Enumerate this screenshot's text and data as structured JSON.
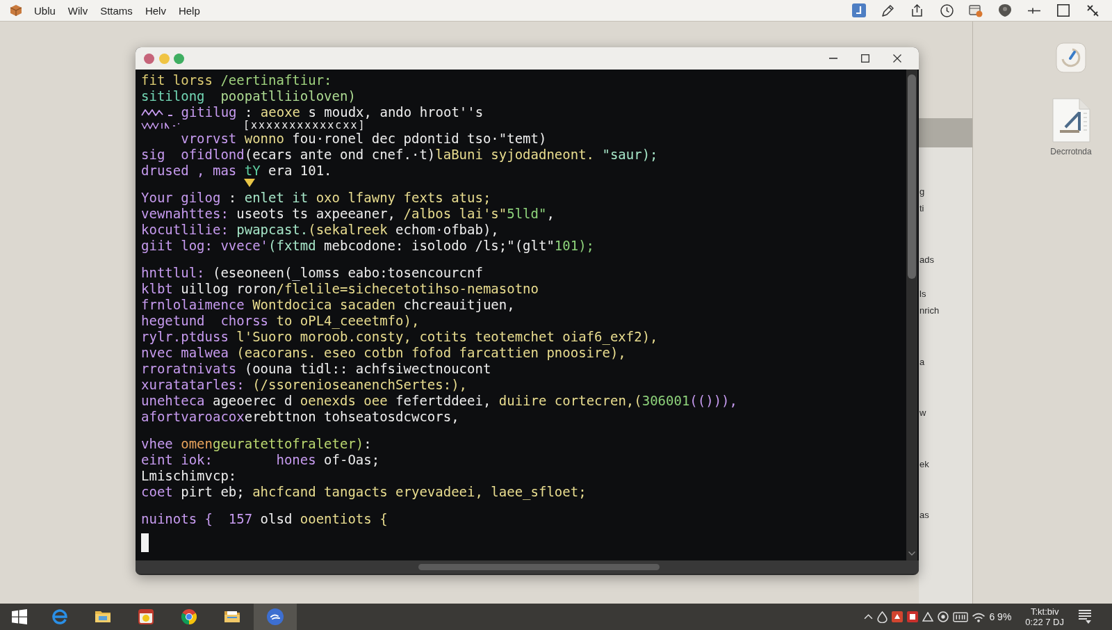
{
  "menu_bar": {
    "items": [
      "Ublu",
      "Wilv",
      "Sttams",
      "Helv",
      "Help"
    ]
  },
  "desktop": {
    "icons": [
      {
        "kind": "gauge"
      },
      {
        "kind": "document",
        "label": "Decrrotnda"
      }
    ]
  },
  "background_window": {
    "labels": [
      "g",
      "ti",
      "ads",
      "ls",
      "nrich",
      "a",
      "w",
      "ek",
      "as"
    ]
  },
  "terminal": {
    "blocks": [
      {
        "lines": [
          {
            "kind": "plain",
            "segments": [
              {
                "text": "fit lorss",
                "color": "#dccb72"
              },
              {
                "text": " /eertinaftiur:",
                "color": "#9fd27e"
              }
            ]
          },
          {
            "kind": "plain",
            "segments": [
              {
                "text": "sitilong",
                "color": "#72d6b4"
              },
              {
                "text": "  poopatlliioloven)",
                "color": "#addb92"
              }
            ]
          },
          {
            "kind": "wavy",
            "segments": [
              {
                "text": " gitilug",
                "color": "#c79bf0"
              },
              {
                "text": " :",
                "color": "#eeeeee"
              },
              {
                "text": " aeoxe",
                "color": "#e9dd8f"
              },
              {
                "text": " s moudx, ando hroot''s",
                "color": "#eeeeee"
              }
            ]
          },
          {
            "kind": "note",
            "segments": [
              {
                "text": "[xxxxxxxxxxxcxx]",
                "color": "#eeeeee"
              }
            ]
          },
          {
            "kind": "plain",
            "segments": [
              {
                "text": "     vrorvst",
                "color": "#c79bf0"
              },
              {
                "text": " wonno",
                "color": "#e9dd8f"
              },
              {
                "text": " fou·ronel dec pdontid tso·\"temt)",
                "color": "#eeeeee"
              }
            ]
          },
          {
            "kind": "plain",
            "segments": [
              {
                "text": "sig  ofidlond",
                "color": "#c79bf0"
              },
              {
                "text": "(ecars ante ond cnef.·t)",
                "color": "#eeeeee"
              },
              {
                "text": "laBuni syjodadneont.",
                "color": "#e9dd8f"
              },
              {
                "text": " \"saur);",
                "color": "#a6e6c8"
              }
            ]
          },
          {
            "kind": "marked",
            "segments": [
              {
                "text": "drused , mas",
                "color": "#c79bf0"
              },
              {
                "text": " tY",
                "color": "#5fd0a2"
              },
              {
                "text": " era 101.",
                "color": "#eeeeee"
              }
            ]
          }
        ]
      },
      {
        "lines": [
          {
            "kind": "plain",
            "segments": [
              {
                "text": "Your gilog",
                "color": "#c79bf0"
              },
              {
                "text": " :",
                "color": "#eeeeee"
              },
              {
                "text": " enlet it",
                "color": "#a6e6c8"
              },
              {
                "text": " oxo lfawny fexts atus;",
                "color": "#e9dd8f"
              }
            ]
          },
          {
            "kind": "plain",
            "segments": [
              {
                "text": "vewnahttes:",
                "color": "#c79bf0"
              },
              {
                "text": " useots ts axpeeaner,",
                "color": "#eeeeee"
              },
              {
                "text": " /albos lai's\"",
                "color": "#e9dd8f"
              },
              {
                "text": "5lld\"",
                "color": "#8ed37b"
              },
              {
                "text": ",",
                "color": "#eeeeee"
              }
            ]
          },
          {
            "kind": "plain",
            "segments": [
              {
                "text": "kocutlilie:",
                "color": "#c79bf0"
              },
              {
                "text": " pwapcast.",
                "color": "#a6e6c8"
              },
              {
                "text": "(sekalreek",
                "color": "#e9dd8f"
              },
              {
                "text": " echom·ofbab),",
                "color": "#eeeeee"
              }
            ]
          },
          {
            "kind": "plain",
            "segments": [
              {
                "text": "giit log: vvece'",
                "color": "#c79bf0"
              },
              {
                "text": "(fxtmd",
                "color": "#a6e6c8"
              },
              {
                "text": " mebcodone: isolodo /ls;\"(glt\"",
                "color": "#eeeeee"
              },
              {
                "text": "101);",
                "color": "#8ed37b"
              }
            ]
          }
        ]
      },
      {
        "lines": [
          {
            "kind": "plain",
            "segments": [
              {
                "text": "hnttlul:",
                "color": "#c79bf0"
              },
              {
                "text": " (eseoneen(_lomss eabo:tosencourcnf",
                "color": "#eeeeee"
              }
            ]
          },
          {
            "kind": "plain",
            "segments": [
              {
                "text": "klbt",
                "color": "#c79bf0"
              },
              {
                "text": " uillog roron",
                "color": "#eeeeee"
              },
              {
                "text": "/flelile=sichecetotihso-nemasotno",
                "color": "#e9dd8f"
              }
            ]
          },
          {
            "kind": "plain",
            "segments": [
              {
                "text": "frnlolaimence",
                "color": "#c79bf0"
              },
              {
                "text": " Wontdocica sacaden",
                "color": "#e9dd8f"
              },
              {
                "text": " chcreauitjuen,",
                "color": "#eeeeee"
              }
            ]
          },
          {
            "kind": "plain",
            "segments": [
              {
                "text": "hegetund  chorss",
                "color": "#c79bf0"
              },
              {
                "text": " to oPL4_ceeetmfo),",
                "color": "#e9dd8f"
              }
            ]
          },
          {
            "kind": "plain",
            "segments": [
              {
                "text": "rylr.ptduss",
                "color": "#c79bf0"
              },
              {
                "text": " l'Suoro moroob.consty, cotits teotemchet oiaf6_exf2),",
                "color": "#e9dd8f"
              }
            ]
          },
          {
            "kind": "plain",
            "segments": [
              {
                "text": "nvec malwea",
                "color": "#c79bf0"
              },
              {
                "text": " (eacorans. eseo cotbn fofod farcattien pnoosire),",
                "color": "#e9dd8f"
              }
            ]
          },
          {
            "kind": "plain",
            "segments": [
              {
                "text": "rroratnivats",
                "color": "#c79bf0"
              },
              {
                "text": " (oouna tidl:: achfsiwectnoucont",
                "color": "#eeeeee"
              }
            ]
          },
          {
            "kind": "plain",
            "segments": [
              {
                "text": "xuratatarles:",
                "color": "#c79bf0"
              },
              {
                "text": " (/ssorenioseanenchSertes:),",
                "color": "#e9dd8f"
              }
            ]
          },
          {
            "kind": "plain",
            "segments": [
              {
                "text": "unehteca",
                "color": "#c79bf0"
              },
              {
                "text": " ageoerec d",
                "color": "#eeeeee"
              },
              {
                "text": " oenexds oee",
                "color": "#e9dd8f"
              },
              {
                "text": " fefertddeei,",
                "color": "#eeeeee"
              },
              {
                "text": " duiire cortecren,(",
                "color": "#e9dd8f"
              },
              {
                "text": "306001",
                "color": "#8ed37b"
              },
              {
                "text": "(())),",
                "color": "#c79bf0"
              }
            ]
          },
          {
            "kind": "plain",
            "segments": [
              {
                "text": "afortvaroacox",
                "color": "#c79bf0"
              },
              {
                "text": "erebttnon tohseatosdcwcors,",
                "color": "#eeeeee"
              }
            ]
          }
        ]
      },
      {
        "lines": [
          {
            "kind": "plain",
            "segments": [
              {
                "text": "vhee",
                "color": "#c79bf0"
              },
              {
                "text": " omen",
                "color": "#e8a35c"
              },
              {
                "text": "geuratettofraleter)",
                "color": "#bcd970"
              },
              {
                "text": ":",
                "color": "#eeeeee"
              }
            ]
          },
          {
            "kind": "plain",
            "segments": [
              {
                "text": "eint iok:        hones",
                "color": "#c79bf0"
              },
              {
                "text": " of-Oas;",
                "color": "#eeeeee"
              }
            ]
          },
          {
            "kind": "plain",
            "segments": [
              {
                "text": "Lmischimvcp:",
                "color": "#eeeeee"
              }
            ]
          },
          {
            "kind": "plain",
            "segments": [
              {
                "text": "coet",
                "color": "#c79bf0"
              },
              {
                "text": " pirt eb;",
                "color": "#eeeeee"
              },
              {
                "text": " ahcfcand tangacts eryevadeei, laee_sfloet;",
                "color": "#e9dd8f"
              }
            ]
          }
        ]
      },
      {
        "lines": [
          {
            "kind": "plain",
            "segments": [
              {
                "text": "nuinots {  157",
                "color": "#c79bf0"
              },
              {
                "text": " olsd",
                "color": "#eeeeee"
              },
              {
                "text": " ooentiots {",
                "color": "#e9dd8f"
              }
            ]
          }
        ]
      }
    ],
    "cursor": true
  },
  "taskbar": {
    "apps": [
      {
        "kind": "browser",
        "selected": false
      },
      {
        "kind": "folder",
        "selected": false
      },
      {
        "kind": "calendar",
        "selected": false
      },
      {
        "kind": "wheel",
        "selected": false
      },
      {
        "kind": "files",
        "selected": false
      },
      {
        "kind": "swirl",
        "selected": true
      }
    ],
    "tray_text": "6 9%",
    "clock_lines": [
      "T:kt:biv",
      "0:22 7 DJ"
    ]
  }
}
